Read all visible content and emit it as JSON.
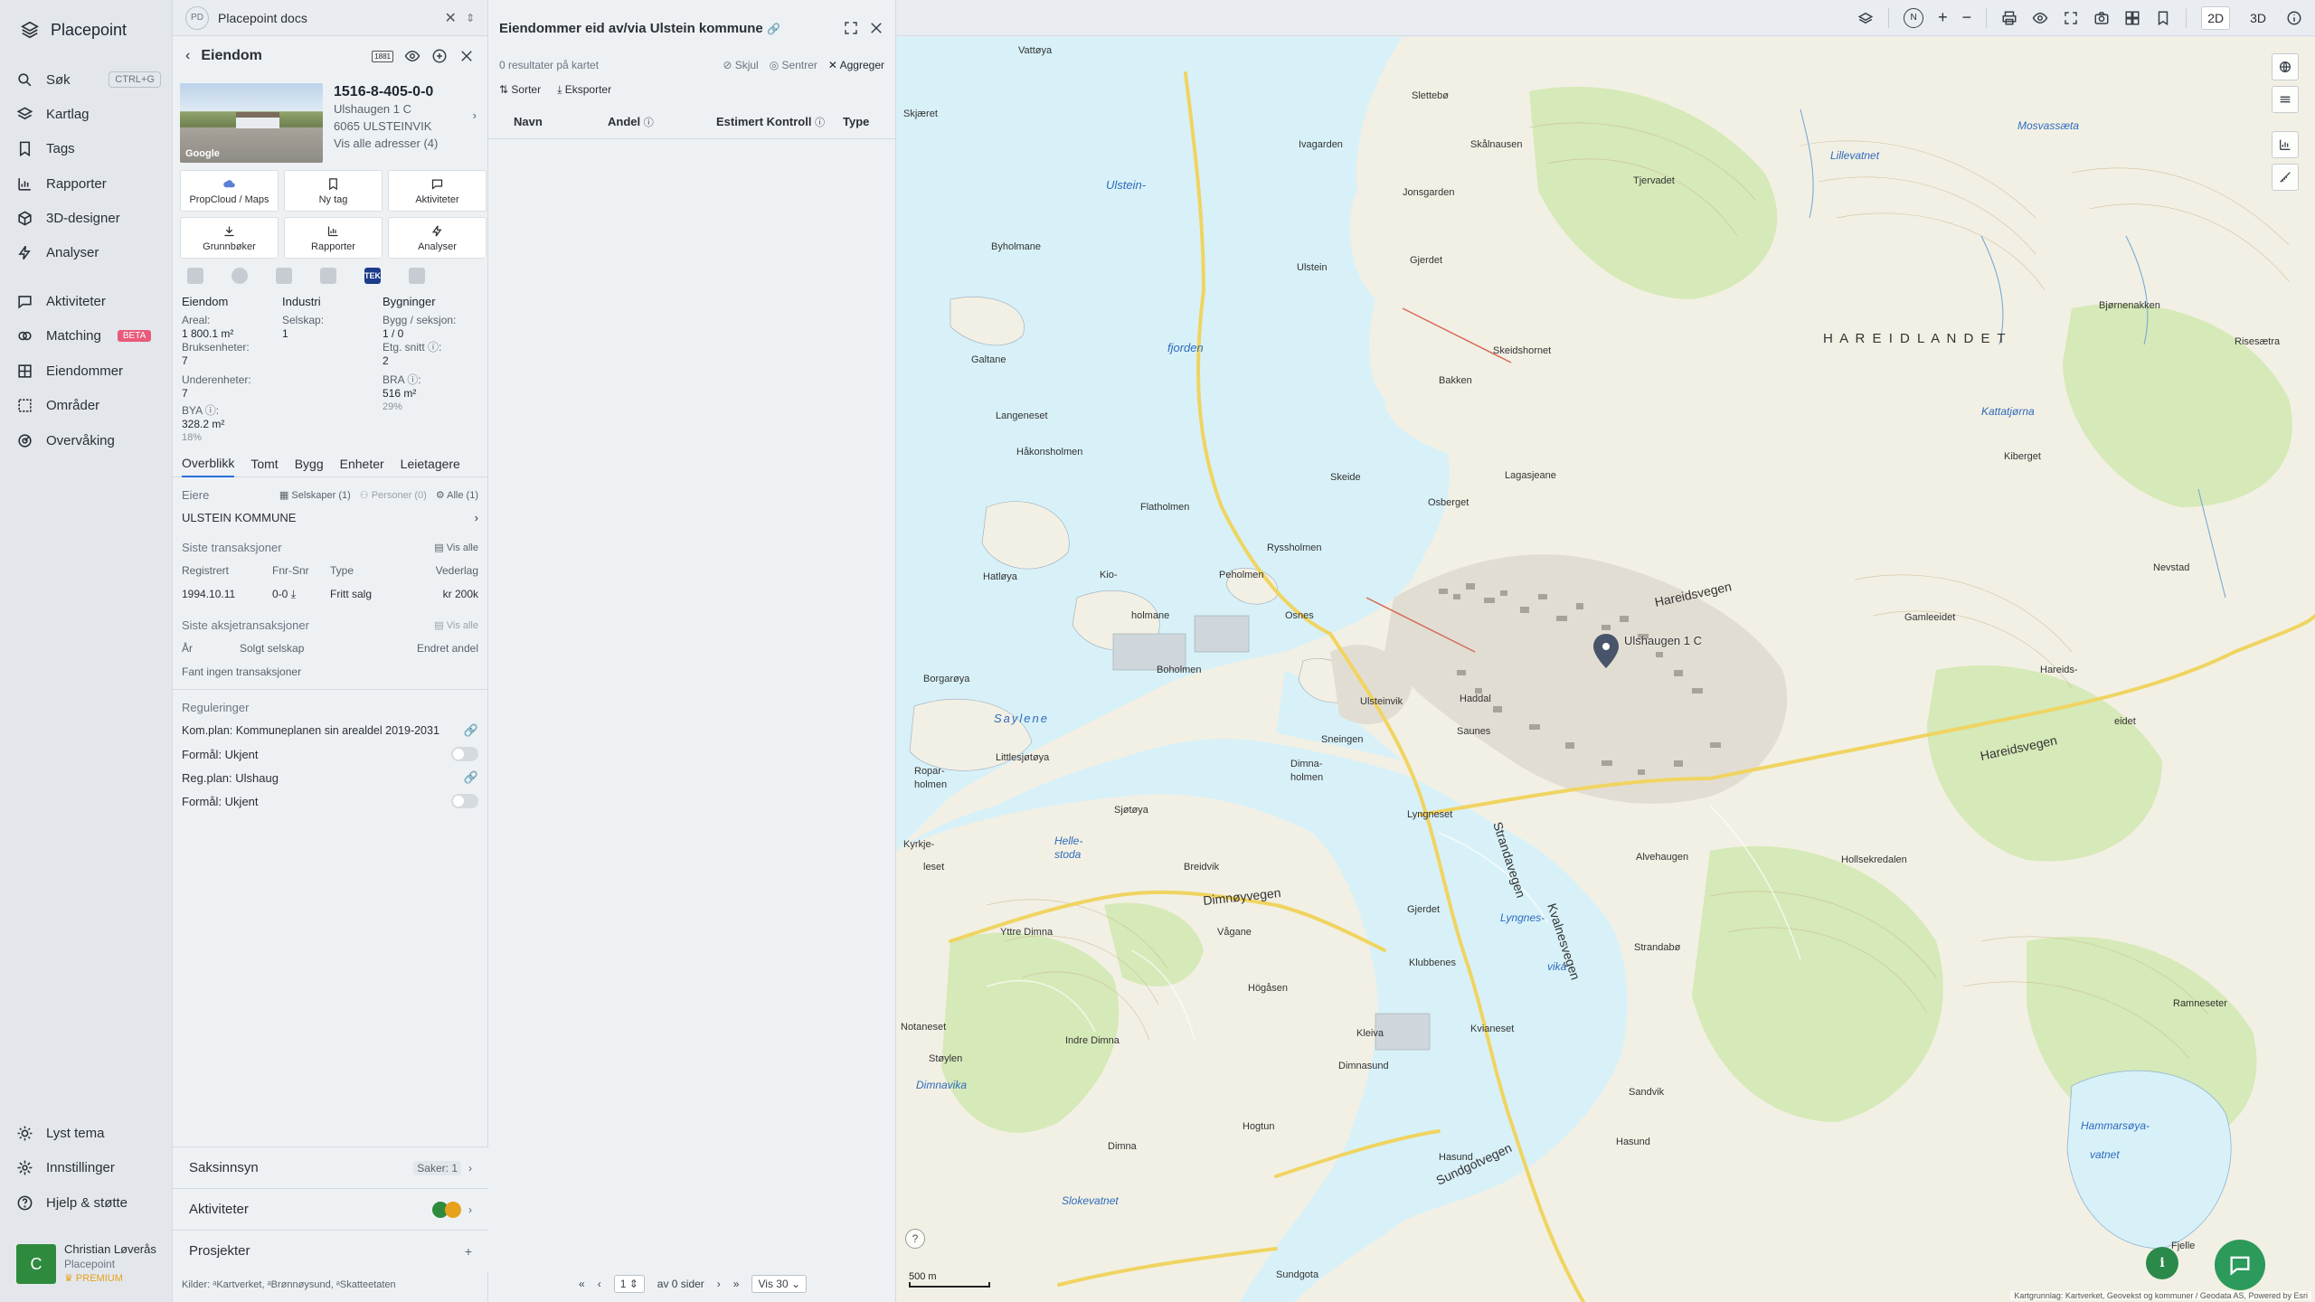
{
  "app": {
    "name": "Placepoint"
  },
  "nav": {
    "items": [
      {
        "label": "Søk",
        "shortcut": "CTRL+G"
      },
      {
        "label": "Kartlag"
      },
      {
        "label": "Tags"
      },
      {
        "label": "Rapporter"
      },
      {
        "label": "3D-designer"
      },
      {
        "label": "Analyser"
      },
      {
        "label": "Aktiviteter"
      },
      {
        "label": "Matching",
        "badge": "BETA"
      },
      {
        "label": "Eiendommer"
      },
      {
        "label": "Områder"
      },
      {
        "label": "Overvåking"
      }
    ],
    "bottom": [
      {
        "label": "Lyst tema"
      },
      {
        "label": "Innstillinger"
      },
      {
        "label": "Hjelp & støtte"
      }
    ],
    "user": {
      "initial": "C",
      "name": "Christian Løverås",
      "company": "Placepoint",
      "plan": "PREMIUM"
    }
  },
  "panel": {
    "doc_tab": {
      "logo": "PD",
      "title": "Placepoint docs"
    },
    "header": {
      "title": "Eiendom",
      "badge": "1881"
    },
    "property": {
      "id": "1516-8-405-0-0",
      "address": "Ulshaugen 1 C",
      "postal": "6065 ULSTEINVIK",
      "all_addresses": "Vis alle adresser (4)",
      "photo_credit": "Google"
    },
    "buttons": [
      {
        "label": "PropCloud / Maps",
        "icon": "cloud-icon"
      },
      {
        "label": "Ny tag",
        "icon": "bookmark-icon"
      },
      {
        "label": "Aktiviteter",
        "icon": "chat-icon"
      },
      {
        "label": "Grunnbøker",
        "icon": "download-icon"
      },
      {
        "label": "Rapporter",
        "icon": "chart-icon"
      },
      {
        "label": "Analyser",
        "icon": "bolt-icon"
      }
    ],
    "tek_label": "TEK",
    "stats": {
      "col1": {
        "head": "Eiendom",
        "areal_label": "Areal:",
        "areal": "1 800.1 m²",
        "bruks_label": "Bruksenheter:",
        "bruks": "7",
        "under_label": "Underenheter:",
        "under": "7",
        "bya_label": "BYA ⓘ:",
        "bya": "328.2 m²",
        "bya_pct": "18%"
      },
      "col2": {
        "head": "Industri",
        "selskap_label": "Selskap:",
        "selskap": "1"
      },
      "col3": {
        "head": "Bygninger",
        "bygg_label": "Bygg / seksjon:",
        "bygg": "1 / 0",
        "etg_label": "Etg. snitt ⓘ:",
        "etg": "2",
        "bra_label": "BRA ⓘ:",
        "bra": "516 m²",
        "bra_pct": "29%"
      }
    },
    "tabs": [
      "Overblikk",
      "Tomt",
      "Bygg",
      "Enheter",
      "Leietagere"
    ],
    "owners": {
      "label": "Eiere",
      "filter_companies": "Selskaper (1)",
      "filter_persons": "Personer (0)",
      "filter_all": "Alle (1)",
      "owner": "ULSTEIN KOMMUNE"
    },
    "transactions": {
      "title": "Siste transaksjoner",
      "show_all": "Vis alle",
      "headers": [
        "Registrert",
        "Fnr-Snr",
        "Type",
        "Vederlag"
      ],
      "row": [
        "1994.10.11",
        "0-0",
        "Fritt salg",
        "kr 200k"
      ]
    },
    "share_tx": {
      "title": "Siste aksjetransaksjoner",
      "show_all": "Vis alle",
      "headers": [
        "År",
        "Solgt selskap",
        "Endret andel"
      ],
      "empty": "Fant ingen transaksjoner"
    },
    "regulations": {
      "title": "Reguleringer",
      "items": [
        {
          "label": "Kom.plan: Kommuneplanen sin arealdel 2019-2031"
        },
        {
          "label": "Formål: Ukjent"
        },
        {
          "label": "Reg.plan: Ulshaug"
        },
        {
          "label": "Formål: Ukjent"
        }
      ]
    },
    "collapsibles": [
      {
        "label": "Saksinnsyn",
        "meta": "Saker: 1"
      },
      {
        "label": "Aktiviteter"
      },
      {
        "label": "Prosjekter"
      }
    ],
    "sources": "Kilder: ᵃKartverket, ᵃBrønnøysund, ᵃSkatteetaten"
  },
  "results": {
    "title": "Eiendommer eid av/via Ulstein kommune",
    "count": "0 resultater på kartet",
    "actions": {
      "hide": "Skjul",
      "center": "Sentrer",
      "aggregate": "Aggreger"
    },
    "tools": {
      "sort": "Sorter",
      "export": "Eksporter"
    },
    "columns": [
      "Navn",
      "Andel",
      "Estimert Kontroll",
      "Type"
    ],
    "pager": {
      "page": "1",
      "of_pages": "av 0 sider",
      "per_page": "Vis 30"
    }
  },
  "topbar": {
    "mode_2d": "2D",
    "mode_3d": "3D",
    "north": "N"
  },
  "map": {
    "pin_label": "Ulshaugen 1 C",
    "scale": "500 m",
    "attribution": "Kartgrunnlag: Kartverket, Geovekst og kommuner / Geodata AS, Powered by Esri",
    "labels": {
      "vattoya": "Vattøya",
      "slettebo": "Slettebø",
      "skjaeret": "Skjæret",
      "ivagarden": "Ivagarden",
      "skalnausen": "Skålnausen",
      "tjervadet": "Tjervadet",
      "ulsteinvik_c": "Ulstein-",
      "jonsgarden": "Jonsgarden",
      "byholmane": "Byholmane",
      "ulstein": "Ulstein",
      "gjerdet": "Gjerdet",
      "bjornenakken": "Bjørnenakken",
      "hareidlandet": "H A R E I D L A N D E T",
      "galtane": "Galtane",
      "fjorden": "fjorden",
      "bakken": "Bakken",
      "skeidshornet": "Skeidshornet",
      "langeneset": "Langeneset",
      "hakonsholmen": "Håkonsholmen",
      "skeide": "Skeide",
      "osbergplet": "Osberget",
      "flatholmen": "Flatholmen",
      "rysshoimen": "Ryssholmen",
      "hatloya": "Hatløya",
      "kio": "Kio-",
      "holmane": "holmane",
      "peholmen": "Peholmen",
      "osnes": "Osnes",
      "boholmen": "Boholmen",
      "ulsteinvik": "Ulsteinvik",
      "saunes": "Saunes",
      "borgaroya": "Borgarøya",
      "saylene": "Saylene",
      "sneingen": "Sneingen",
      "littlesjoeya": "Littlesjøtøya",
      "dimnaholmen": "Dimna-",
      "holmen": "holmen",
      "sjoetoya": "Sjøtøya",
      "lyngneset": "Lyngneset",
      "breidvik": "Breidvik",
      "dimnoyvegen": "Dimnøyvegen",
      "gjerdet2": "Gjerdet",
      "lyngnes": "Lyngnes-",
      "vika": "vika",
      "klubbenes": "Klubbenes",
      "vagane": "Vågane",
      "hogasen": "Högåsen",
      "kleiva": "Kleiva",
      "dimnasund": "Dimnasund",
      "kvianeset": "Kvianeset",
      "notaneset": "Notaneset",
      "indre_dimna": "Indre Dimna",
      "hogtun": "Hogtun",
      "dimna": "Dimna",
      "slokevatnet": "Slokevatnet",
      "sandvik": "Sandvik",
      "sundgotvegen": "Sundgotvegen",
      "hasund": "Hasund",
      "sundgota": "Sundgota",
      "hareidsvegen": "Hareidsvegen",
      "strandavegen": "Strandavegen",
      "kvalnesvegen": "Kvalnesvegen",
      "alvehaugen": "Alvehaugen",
      "strandabo": "Strandabø",
      "hollsekredalen": "Hollsekredalen",
      "nevstad": "Nevstad",
      "gamleeidet": "Gamleeidet",
      "haddal": "Haddal",
      "eidet": "eidet",
      "hareids": "Hareids-",
      "riseseatra": "Risesætra",
      "kiberget": "Kiberget",
      "lillevatnet": "Lillevatnet",
      "mosvassata": "Mosvassæta",
      "kattatjorna": "Kattatjørna",
      "ramneseter": "Ramneseter",
      "hammarsoya": "Hammarsøya-",
      "vatnet": "vatnet",
      "fjelle": "Fjelle",
      "lagasjeane": "Lagasjeane",
      "helle": "Helle-",
      "stoda": "stoda",
      "yttre_dimna": "Yttre Dimna",
      "stoylen": "Støylen",
      "dimnavika": "Dimnavika",
      "ropar": "Ropar-",
      "holmen2": "holmen",
      "kyrkje": "Kyrkje-",
      "leset": "leset"
    }
  }
}
